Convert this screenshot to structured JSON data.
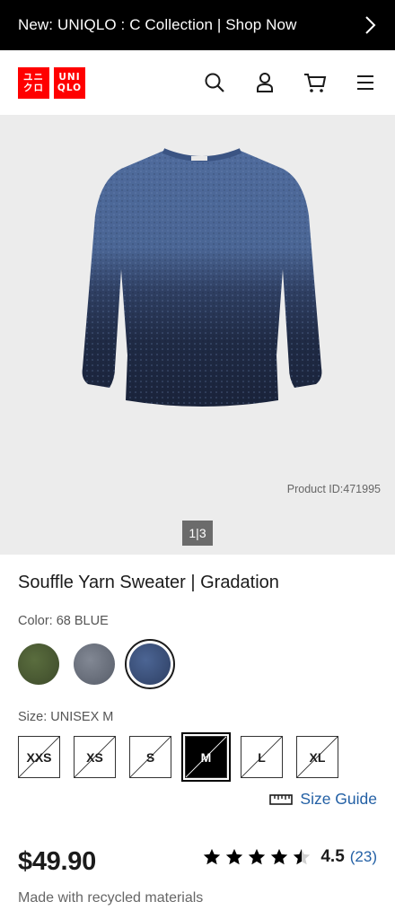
{
  "promo": {
    "text": "New: UNIQLO : C Collection | Shop Now"
  },
  "logo": {
    "top_left": "ユニ",
    "bottom_left": "クロ",
    "top_right": "UNI",
    "bottom_right": "QLO"
  },
  "product": {
    "id_text": "Product ID:471995",
    "pager": "1|3",
    "title": "Souffle Yarn Sweater | Gradation",
    "color_label": "Color: 68 BLUE",
    "size_label": "Size: UNISEX M",
    "sizes": [
      "XXS",
      "XS",
      "S",
      "M",
      "L",
      "XL"
    ],
    "size_guide": "Size Guide",
    "price": "$49.90",
    "rating_value": "4.5",
    "rating_count": "(23)",
    "rating_stars": 4.5,
    "note": "Made with recycled materials"
  },
  "colors": {
    "swatches": [
      "#4c5e35",
      "#6e7480",
      "#3a5078"
    ],
    "selected_swatch_index": 2,
    "accent_link": "#2360a5",
    "brand_red": "#ff0000"
  },
  "icons": [
    "search-icon",
    "account-icon",
    "cart-icon",
    "menu-icon",
    "chevron-right-icon",
    "ruler-icon",
    "star-icon"
  ]
}
